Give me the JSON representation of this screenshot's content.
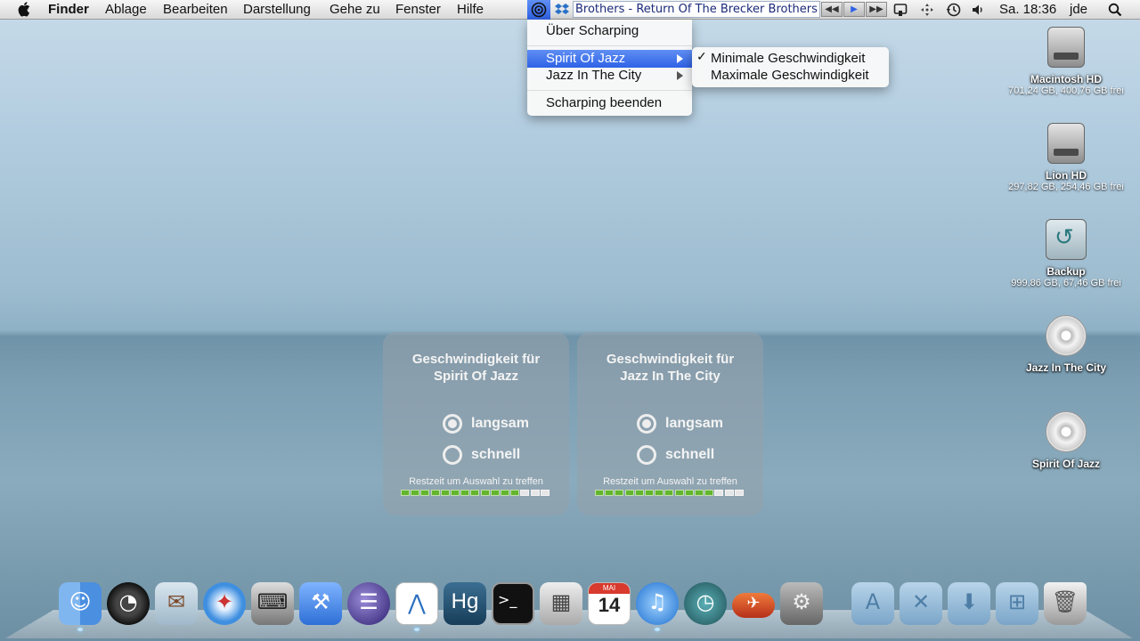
{
  "menubar": {
    "apple": "apple-icon",
    "items": [
      "Finder",
      "Ablage",
      "Bearbeiten",
      "Darstellung",
      "Gehe zu",
      "Fenster",
      "Hilfe"
    ],
    "now_playing": "Brothers - Return Of The Brecker Brothers",
    "clock": "Sa. 18:36",
    "user": "jde"
  },
  "scharping_menu": {
    "items": [
      "Über Scharping",
      "Spirit Of Jazz",
      "Jazz In The City",
      "Scharping beenden"
    ],
    "selected": "Spirit Of Jazz"
  },
  "speed_submenu": {
    "items": [
      "Minimale Geschwindigkeit",
      "Maximale Geschwindigkeit"
    ],
    "checked": "Minimale Geschwindigkeit",
    "checkmark": "✓"
  },
  "desktop_icons": [
    {
      "name": "Macintosh HD",
      "info": "701,24 GB, 400,76 GB frei",
      "kind": "hard-drive-icon"
    },
    {
      "name": "Lion HD",
      "info": "297,82 GB, 254,46 GB frei",
      "kind": "hard-drive-icon"
    },
    {
      "name": "Backup",
      "info": "999,86 GB, 67,46 GB frei",
      "kind": "time-machine-drive-icon"
    },
    {
      "name": "Jazz In The City",
      "info": "",
      "kind": "cd-icon"
    },
    {
      "name": "Spirit Of Jazz",
      "info": "",
      "kind": "cd-icon"
    }
  ],
  "panels": [
    {
      "title_line1": "Geschwindigkeit für",
      "title_line2": "Spirit Of Jazz",
      "option_slow": "langsam",
      "option_fast": "schnell",
      "selected": "langsam",
      "hint": "Restzeit um Auswahl zu treffen",
      "remaining_fraction": 0.8
    },
    {
      "title_line1": "Geschwindigkeit für",
      "title_line2": "Jazz In The City",
      "option_slow": "langsam",
      "option_fast": "schnell",
      "selected": "langsam",
      "hint": "Restzeit um Auswahl zu treffen",
      "remaining_fraction": 0.8
    }
  ],
  "dock": {
    "apps": [
      "Finder",
      "Dashboard",
      "Mail",
      "Safari",
      "Typewriter",
      "Xcode",
      "Eclipse",
      "Wunderlist",
      "Mercurial",
      "Terminal",
      "Rechner",
      "Kalender",
      "iTunes",
      "Time Machine",
      "Mailplane",
      "Systemeinstellungen",
      "Programme",
      "Dienstprogramme",
      "Downloads",
      "Dokumente",
      "Papierkorb"
    ],
    "calendar_day": "14",
    "calendar_month": "MAI",
    "mercurial_label": "Hg"
  }
}
